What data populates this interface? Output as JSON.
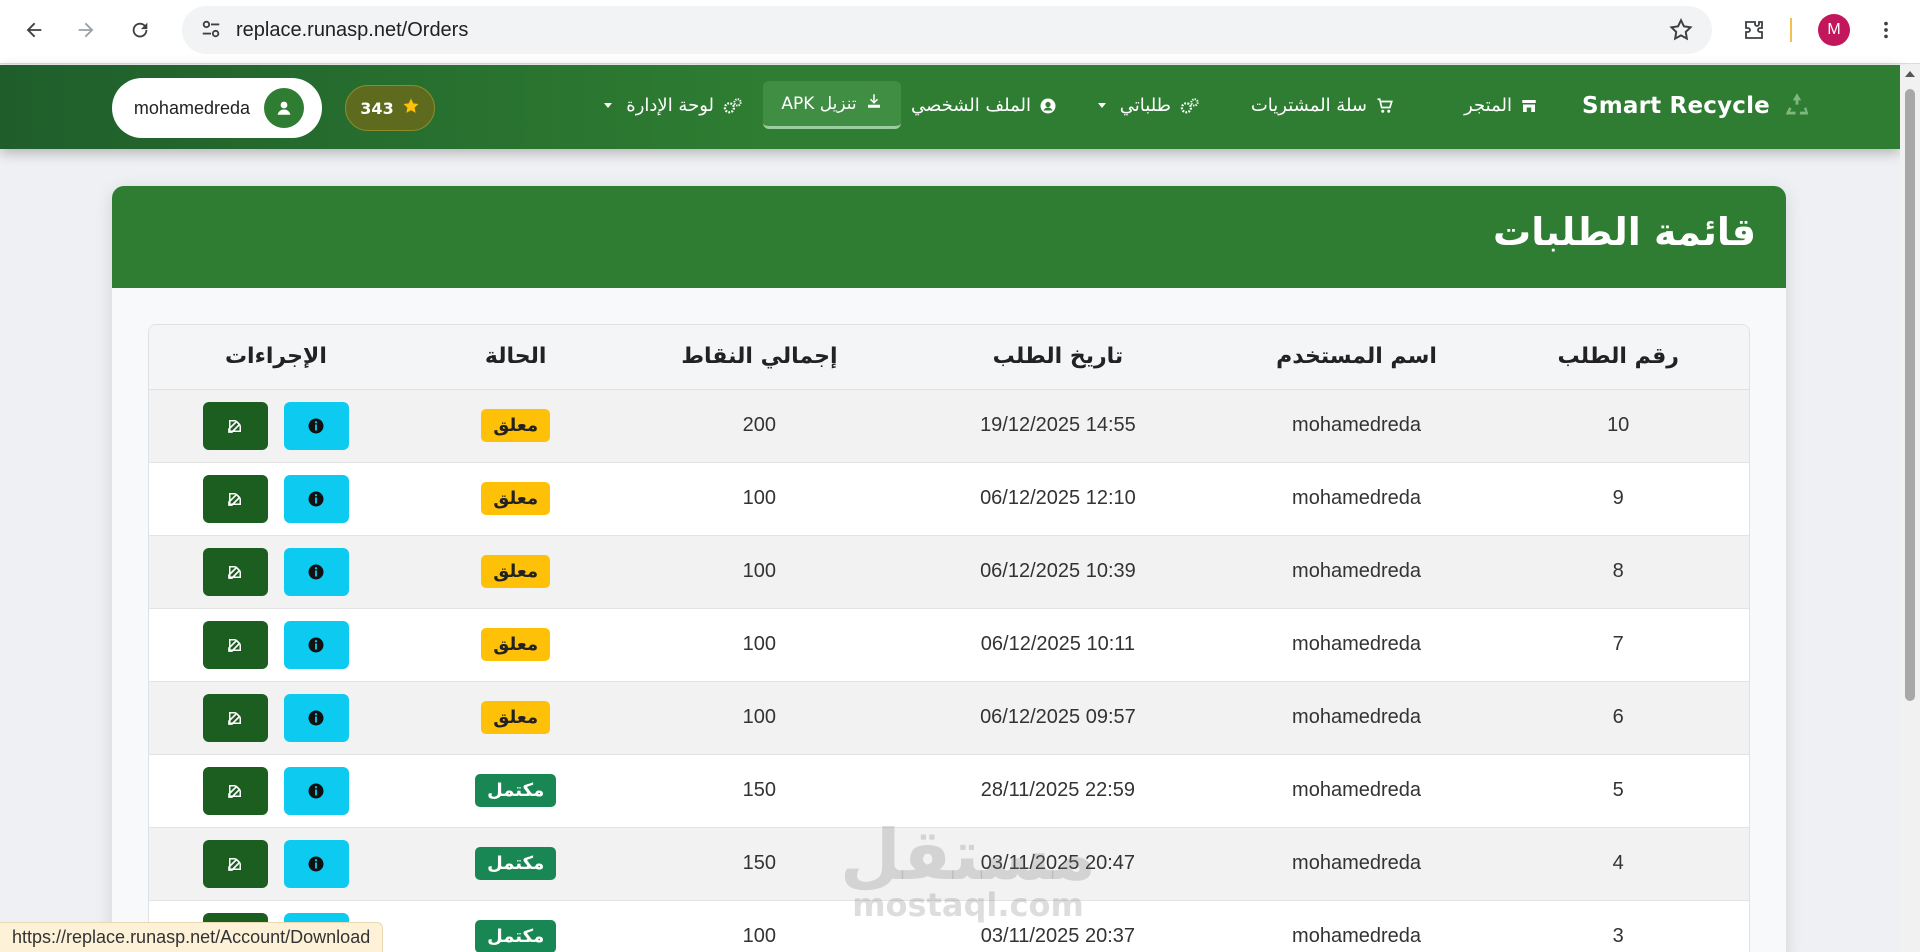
{
  "browser": {
    "url": "replace.runasp.net/Orders",
    "profile_initial": "M",
    "status_url": "https://replace.runasp.net/Account/Download"
  },
  "navbar": {
    "brand": "Smart Recycle",
    "items": [
      {
        "label": "المتجر",
        "icon": "store-icon"
      },
      {
        "label": "سلة المشتريات",
        "icon": "cart-icon"
      },
      {
        "label": "طلباتي",
        "icon": "gears-icon"
      },
      {
        "label": "الملف الشخصي",
        "icon": "user-circle-icon"
      },
      {
        "label": "لوحة الإدارة",
        "icon": "gears-icon"
      }
    ],
    "apk_label": "تنزيل APK",
    "points": "343",
    "username": "mohamedreda"
  },
  "card": {
    "title": "قائمة الطلبات"
  },
  "table": {
    "headers": [
      "رقم الطلب",
      "اسم المستخدم",
      "تاريخ الطلب",
      "إجمالي النقاط",
      "الحالة",
      "الإجراءات"
    ],
    "rows": [
      {
        "id": "10",
        "user": "mohamedreda",
        "date": "19/12/2025 14:55",
        "points": "200",
        "status": "معلق",
        "state": "pending"
      },
      {
        "id": "9",
        "user": "mohamedreda",
        "date": "06/12/2025 12:10",
        "points": "100",
        "status": "معلق",
        "state": "pending"
      },
      {
        "id": "8",
        "user": "mohamedreda",
        "date": "06/12/2025 10:39",
        "points": "100",
        "status": "معلق",
        "state": "pending"
      },
      {
        "id": "7",
        "user": "mohamedreda",
        "date": "06/12/2025 10:11",
        "points": "100",
        "status": "معلق",
        "state": "pending"
      },
      {
        "id": "6",
        "user": "mohamedreda",
        "date": "06/12/2025 09:57",
        "points": "100",
        "status": "معلق",
        "state": "pending"
      },
      {
        "id": "5",
        "user": "mohamedreda",
        "date": "28/11/2025 22:59",
        "points": "150",
        "status": "مكتمل",
        "state": "done"
      },
      {
        "id": "4",
        "user": "mohamedreda",
        "date": "03/11/2025 20:47",
        "points": "150",
        "status": "مكتمل",
        "state": "done"
      },
      {
        "id": "3",
        "user": "mohamedreda",
        "date": "03/11/2025 20:37",
        "points": "100",
        "status": "مكتمل",
        "state": "done"
      }
    ]
  },
  "watermark": {
    "ar": "مستقل",
    "en": "mostaql.com"
  },
  "colors": {
    "primary": "#2e7d32",
    "pending": "#ffc107",
    "done": "#198754",
    "info": "#0dcaf0"
  }
}
